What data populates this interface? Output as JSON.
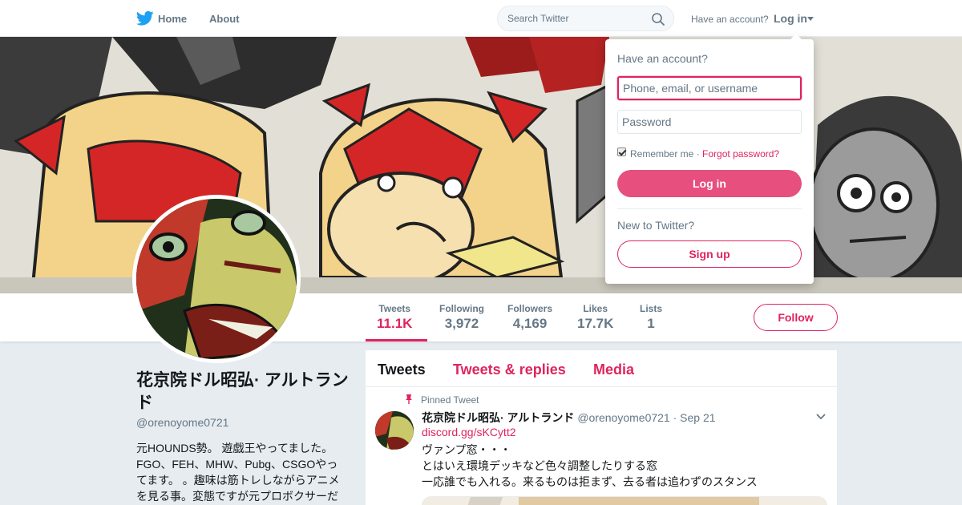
{
  "nav": {
    "home_label": "Home",
    "about_label": "About",
    "search_placeholder": "Search Twitter",
    "have_account": "Have an account?",
    "login_label": "Log in"
  },
  "profile": {
    "display_name": "花京院ドル昭弘· アルトランド",
    "screen_name": "@orenoyome0721",
    "bio": "元HOUNDS勢。 遊戯王やってました。FGO、FEH、MHW、Pubg、CSGOやってます。 。趣味は筋トレしながらアニメを見る事。変態ですが元プロボクサーだ",
    "follow_label": "Follow"
  },
  "stats": [
    {
      "label": "Tweets",
      "value": "11.1K"
    },
    {
      "label": "Following",
      "value": "3,972"
    },
    {
      "label": "Followers",
      "value": "4,169"
    },
    {
      "label": "Likes",
      "value": "17.7K"
    },
    {
      "label": "Lists",
      "value": "1"
    }
  ],
  "timeline": {
    "tabs": [
      "Tweets",
      "Tweets & replies",
      "Media"
    ],
    "pinned_label": "Pinned Tweet",
    "tweet": {
      "name": "花京院ドル昭弘· アルトランド",
      "handle": "@orenoyome0721",
      "separator": "·",
      "date": "Sep 21",
      "link": "discord.gg/sKCytt2",
      "lines": [
        "ヴァンプ窓・・・",
        "とはいえ環境デッキなど色々調整したりする窓",
        "一応誰でも入れる。来るものは拒まず、去る者は追わずのスタンス"
      ]
    }
  },
  "login_dropdown": {
    "title": "Have an account?",
    "username_placeholder": "Phone, email, or username",
    "password_placeholder": "Password",
    "remember_label": "Remember me",
    "separator": "·",
    "forgot_label": "Forgot password?",
    "login_button": "Log in",
    "new_label": "New to Twitter?",
    "signup_button": "Sign up"
  },
  "colors": {
    "accent": "#e0245e",
    "twitter_blue": "#1da1f2",
    "background": "#e6ecf0"
  },
  "icons": [
    "twitter-bird-icon",
    "search-icon",
    "caret-down-icon",
    "pin-icon",
    "chevron-down-icon"
  ]
}
